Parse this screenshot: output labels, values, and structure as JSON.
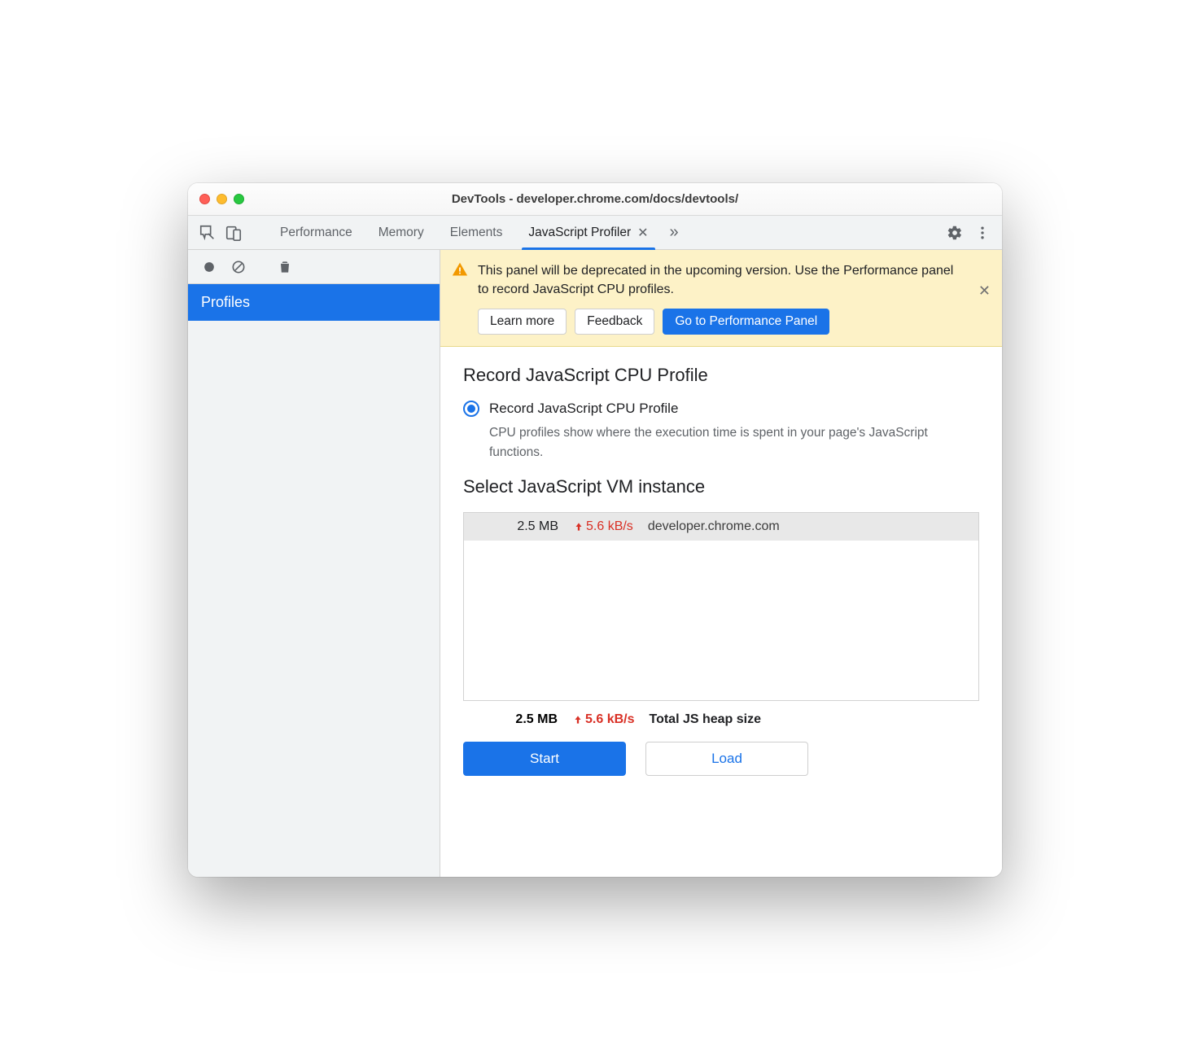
{
  "window_title": "DevTools - developer.chrome.com/docs/devtools/",
  "tabs": {
    "items": [
      {
        "label": "Performance"
      },
      {
        "label": "Memory"
      },
      {
        "label": "Elements"
      },
      {
        "label": "JavaScript Profiler",
        "active": true,
        "closable": true
      }
    ]
  },
  "sidebar": {
    "heading": "Profiles"
  },
  "banner": {
    "text": "This panel will be deprecated in the upcoming version. Use the Performance panel to record JavaScript CPU profiles.",
    "learn_more": "Learn more",
    "feedback": "Feedback",
    "go_to_perf": "Go to Performance Panel"
  },
  "profile_section": {
    "title": "Record JavaScript CPU Profile",
    "option_label": "Record JavaScript CPU Profile",
    "option_desc": "CPU profiles show where the execution time is spent in your page's JavaScript functions."
  },
  "vm_section": {
    "title": "Select JavaScript VM instance",
    "rows": [
      {
        "size": "2.5 MB",
        "rate": "5.6 kB/s",
        "host": "developer.chrome.com"
      }
    ],
    "total_size": "2.5 MB",
    "total_rate": "5.6 kB/s",
    "total_label": "Total JS heap size"
  },
  "actions": {
    "start": "Start",
    "load": "Load"
  }
}
